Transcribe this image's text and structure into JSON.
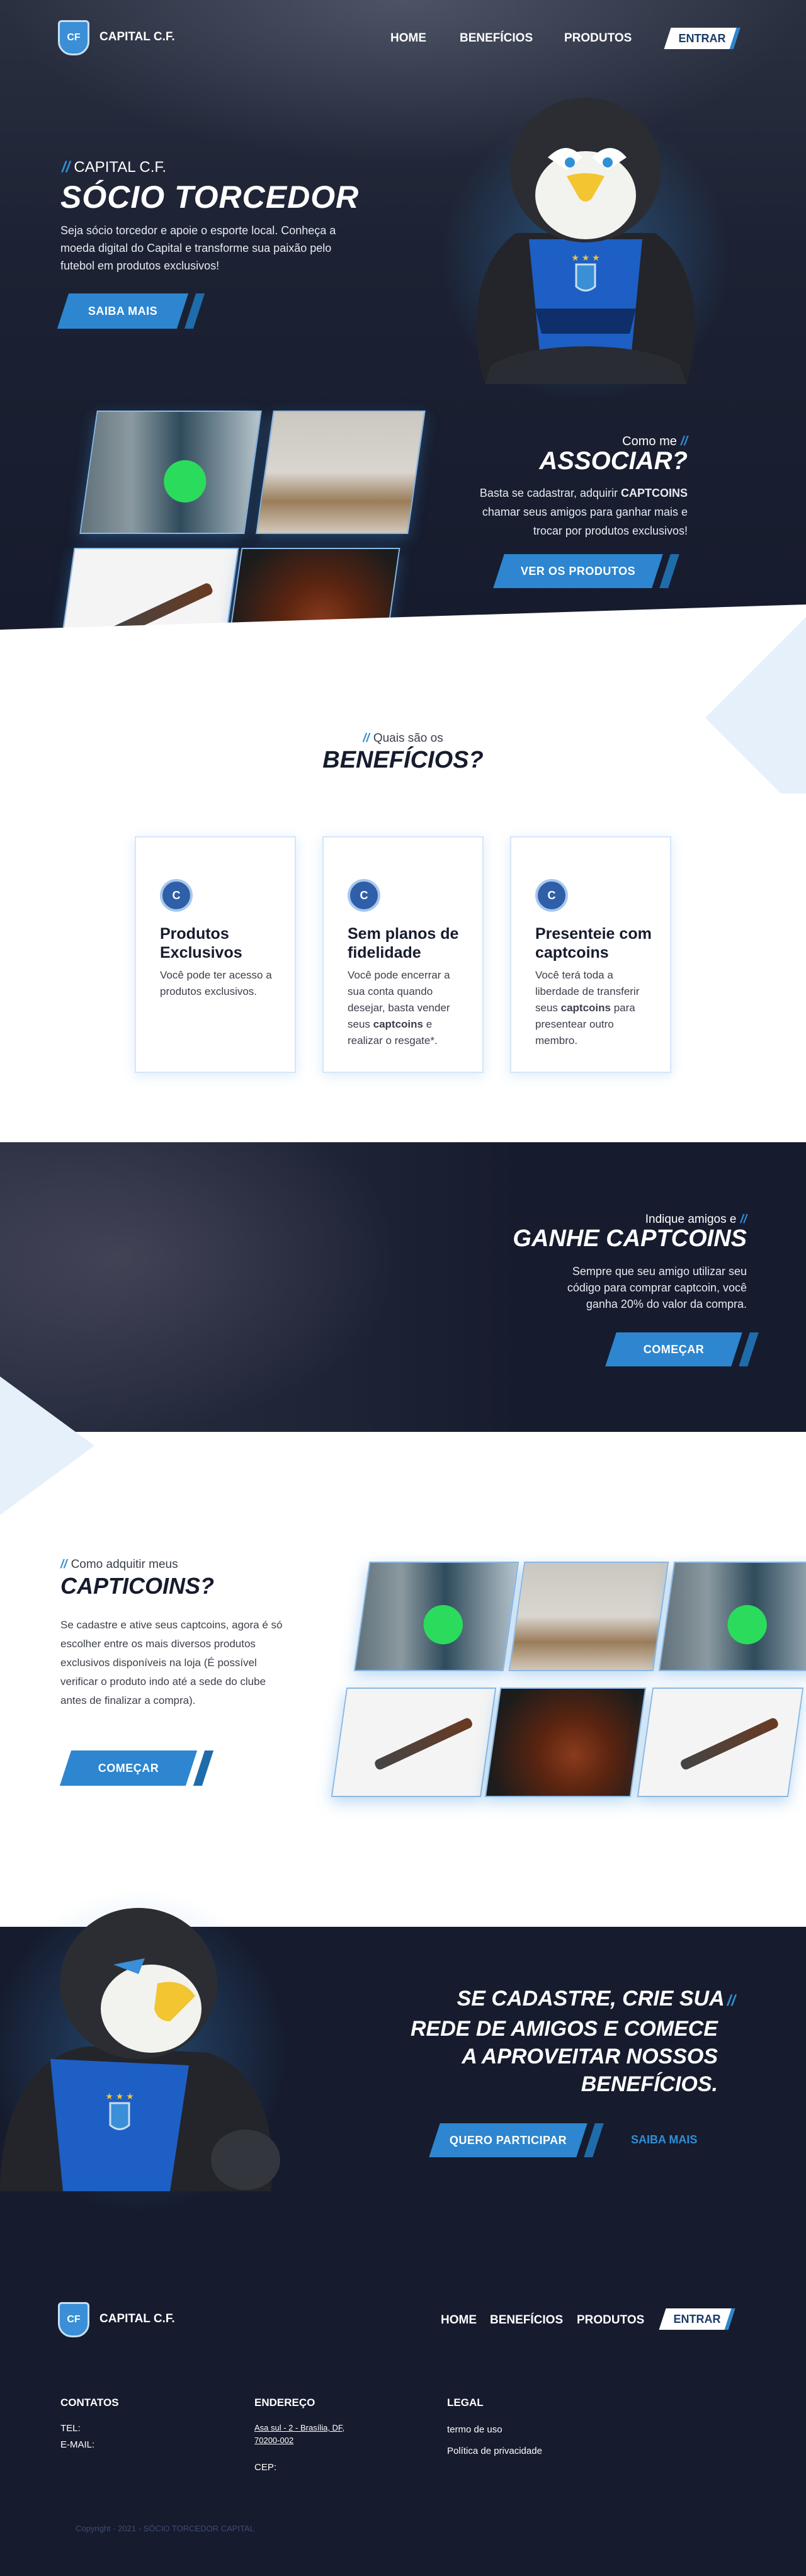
{
  "header": {
    "brand": "CAPITAL C.F.",
    "nav": [
      "HOME",
      "BENEFÍCIOS",
      "PRODUTOS"
    ],
    "login": "ENTRAR"
  },
  "hero": {
    "kicker": "CAPITAL C.F.",
    "title": "SÓCIO TORCEDOR",
    "text": "Seja sócio torcedor e apoie o esporte local. Conheça a moeda digital do Capital e transforme sua paixão pelo futebol em produtos exclusivos!",
    "button": "SAIBA MAIS"
  },
  "associate": {
    "kicker": "Como me",
    "title": "ASSOCIAR?",
    "text_before": "Basta se cadastrar, adquirir ",
    "text_bold": "CAPTCOINS",
    "text_after": " chamar seus amigos para ganhar mais e trocar por produtos exclusivos!",
    "button": "VER OS PRODUTOS"
  },
  "benefits": {
    "kicker": "Quais são os",
    "title": "BENEFÍCIOS?",
    "cards": [
      {
        "title": "Produtos Exclusivos",
        "text": "Você pode ter acesso a produtos exclusivos."
      },
      {
        "title": "Sem planos de fidelidade",
        "text_before": "Você pode encerrar a sua conta quando desejar, basta vender seus ",
        "text_bold": "captcoins",
        "text_after": " e realizar o resgate*."
      },
      {
        "title": "Presenteie com captcoins",
        "text_before": "Você terá toda a liberdade de transferir seus ",
        "text_bold": "captcoins",
        "text_after": " para presentear outro membro."
      }
    ]
  },
  "invite": {
    "kicker": "Indique amigos e",
    "title": "GANHE CAPTCOINS",
    "text": "Sempre que seu amigo utilizar seu código para comprar captcoin, você ganha 20% do valor da compra.",
    "button": "COMEÇAR"
  },
  "buy": {
    "kicker": "Como adquitir meus",
    "title": "CAPTICOINS?",
    "text": "Se cadastre e ative seus captcoins, agora é só escolher entre os mais diversos produtos exclusivos disponíveis na loja (É possível verificar o produto indo até a sede do clube antes de finalizar a compra).",
    "button": "COMEÇAR"
  },
  "cta": {
    "title_lines": [
      "SE CADASTRE, CRIE SUA",
      "REDE DE AMIGOS E COMECE",
      "A APROVEITAR NOSSOS",
      "BENEFÍCIOS."
    ],
    "primary": "QUERO PARTICIPAR",
    "secondary": "SAIBA MAIS"
  },
  "footer": {
    "brand": "CAPITAL C.F.",
    "nav": [
      "HOME",
      "BENEFÍCIOS",
      "PRODUTOS"
    ],
    "login": "ENTRAR",
    "contacts_title": "CONTATOS",
    "tel": "TEL:",
    "email": "E-MAIL:",
    "address_title": "ENDEREÇO",
    "address": "Asa sul - 2 - Brasília, DF, 70200-002",
    "cep": "CEP:",
    "legal_title": "LEGAL",
    "terms": "termo de uso",
    "privacy": "Política de privacidade",
    "copyright": "Copyright - 2021 - SÓCIO TORCEDOR CAPITAL"
  },
  "colors": {
    "dark": "#161b2d",
    "accent": "#2d86cf",
    "light_accent": "#e6f0fa"
  }
}
